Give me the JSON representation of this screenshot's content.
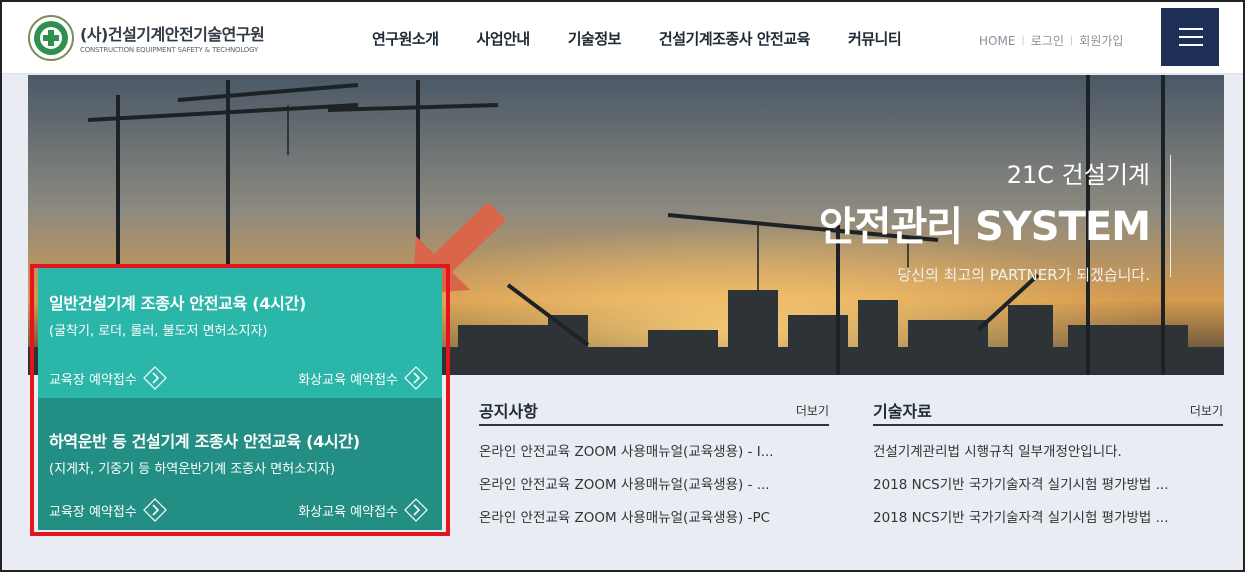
{
  "header": {
    "logo_title": "(사)건설기계안전기술연구원",
    "logo_subtitle": "CONSTRUCTION EQUIPMENT SAFETY & TECHNOLOGY",
    "nav": [
      "연구원소개",
      "사업안내",
      "기술정보",
      "건설기계조종사 안전교육",
      "커뮤니티"
    ],
    "util": [
      "HOME",
      "로그인",
      "회원가입"
    ],
    "colors": {
      "menu_button": "#1f3058"
    }
  },
  "hero": {
    "line1": "21C 건설기계",
    "line2": "안전관리 SYSTEM",
    "line3": "당신의 최고의 PARTNER가 되겠습니다."
  },
  "courses": [
    {
      "title": "일반건설기계 조종사 안전교육 (4시간)",
      "subtitle": "(굴착기, 로더, 롤러, 불도저 면허소지자)",
      "link_left": "교육장 예약접수",
      "link_right": "화상교육 예약접수",
      "color": "#2bb6aa"
    },
    {
      "title": "하역운반 등 건설기계 조종사 안전교육 (4시간)",
      "subtitle": "(지게차, 기중기 등 하역운반기계 조종사 면허소지자)",
      "link_left": "교육장 예약접수",
      "link_right": "화상교육 예약접수",
      "color": "#238f84"
    }
  ],
  "notice": {
    "title": "공지사항",
    "more": "더보기",
    "items": [
      "온라인 안전교육 ZOOM 사용매뉴얼(교육생용) - I...",
      "온라인 안전교육 ZOOM 사용매뉴얼(교육생용) - ...",
      "온라인 안전교육 ZOOM 사용매뉴얼(교육생용) -PC"
    ]
  },
  "tech": {
    "title": "기술자료",
    "more": "더보기",
    "items": [
      "건설기계관리법 시행규칙 일부개정안입니다.",
      "2018 NCS기반 국가기술자격 실기시험 평가방법 ...",
      "2018 NCS기반 국가기술자격 실기시험 평가방법 ..."
    ]
  },
  "annotation": {
    "arrow_icon": "arrow-down-left-icon",
    "highlight_color": "#e5151d",
    "arrow_color": "#d9654a"
  }
}
